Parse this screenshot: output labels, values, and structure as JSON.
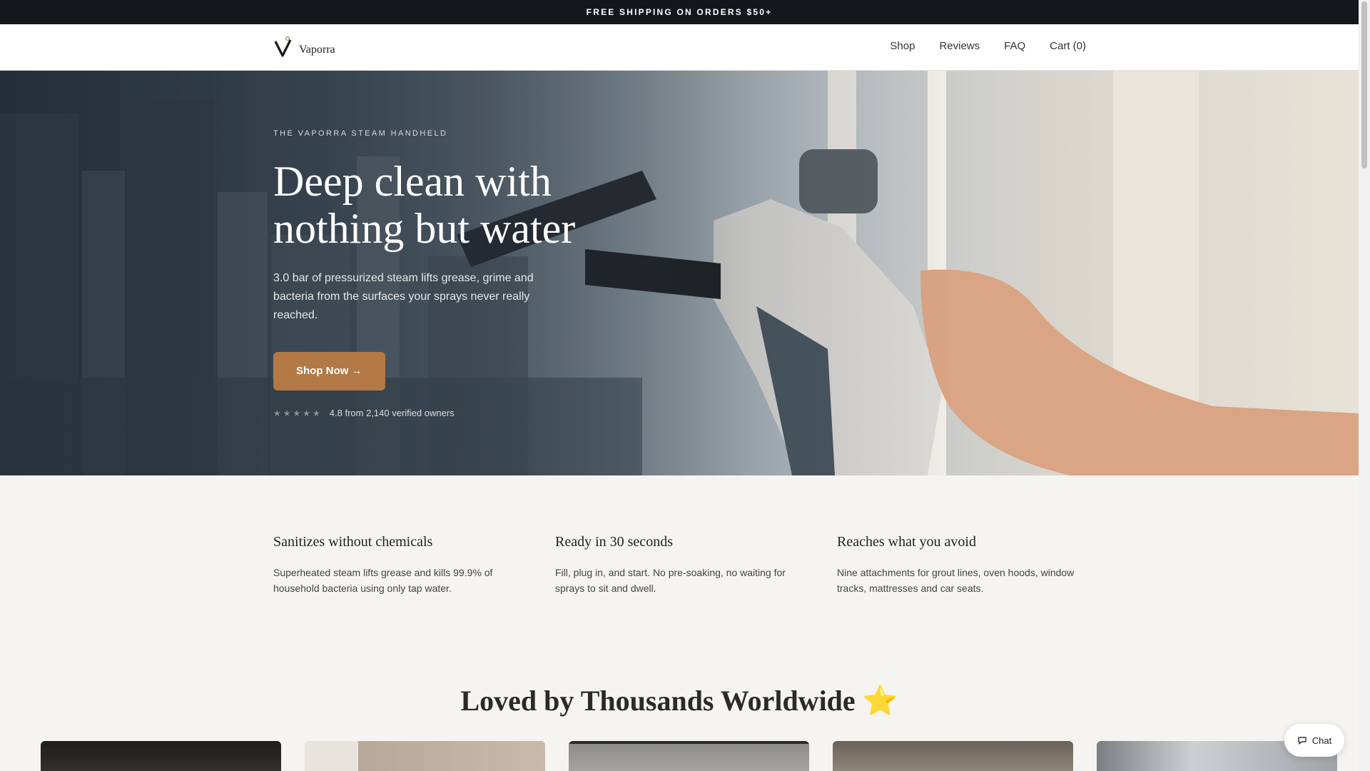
{
  "announcement": "FREE SHIPPING ON ORDERS $50+",
  "header": {
    "logo_text": "Vaporra",
    "nav": [
      "Shop",
      "Reviews",
      "FAQ",
      "Cart (0)"
    ]
  },
  "hero": {
    "eyebrow": "THE VAPORRA STEAM HANDHELD",
    "headline_line1": "Deep clean with",
    "headline_line2": "nothing but water",
    "subcopy": "3.0 bar of pressurized steam lifts grease, grime and bacteria from the surfaces your sprays never really reached.",
    "cta_label": "Shop Now →",
    "stars": "★★★★★",
    "rating_text": "4.8 from 2,140 verified owners"
  },
  "features": [
    {
      "title": "Sanitizes without chemicals",
      "text": "Superheated steam lifts grease and kills 99.9% of household bacteria using only tap water."
    },
    {
      "title": "Ready in 30 seconds",
      "text": "Fill, plug in, and start. No pre-soaking, no waiting for sprays to sit and dwell."
    },
    {
      "title": "Reaches what you avoid",
      "text": "Nine attachments for grout lines, oven hoods, window tracks, mattresses and car seats."
    }
  ],
  "testimonials": {
    "heading": "Loved by Thousands Worldwide",
    "heading_emoji": "⭐"
  },
  "chat": {
    "label": "Chat"
  },
  "colors": {
    "accent": "#b27947",
    "topbar": "#14181c",
    "background": "#f6f4f1"
  }
}
